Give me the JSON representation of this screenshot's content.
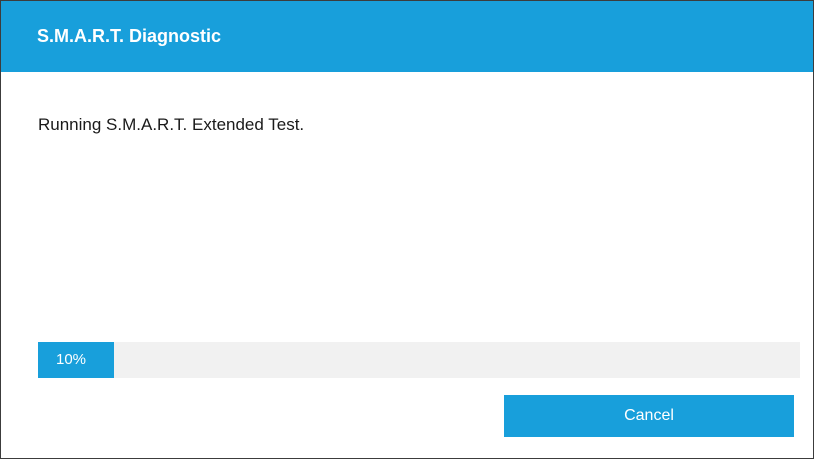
{
  "window": {
    "title": "S.M.A.R.T. Diagnostic"
  },
  "content": {
    "message": "Running S.M.A.R.T. Extended Test."
  },
  "progress": {
    "value_percent": 10,
    "label": "10%"
  },
  "actions": {
    "cancel_label": "Cancel"
  },
  "colors": {
    "accent": "#189fdb",
    "track": "#f1f1f1",
    "text": "#1a1a1a",
    "border": "#3c3c3c"
  }
}
